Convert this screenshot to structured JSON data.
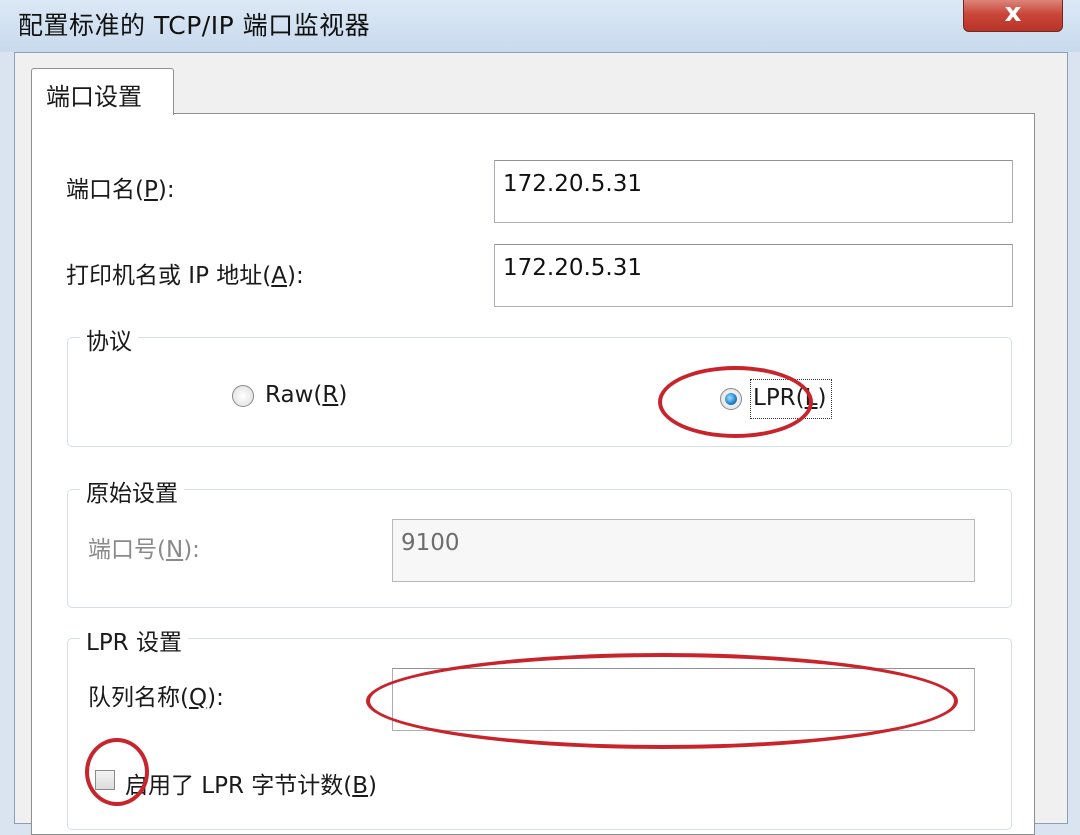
{
  "window": {
    "title": "配置标准的 TCP/IP 端口监视器",
    "close_glyph": "x"
  },
  "tab": {
    "label": "端口设置"
  },
  "port_name": {
    "label_pre": "端口名(",
    "mnemonic": "P",
    "label_post": "):",
    "value": "172.20.5.31"
  },
  "printer_name": {
    "label_pre": "打印机名或 IP 地址(",
    "mnemonic": "A",
    "label_post": "):",
    "value": "172.20.5.31"
  },
  "protocol": {
    "legend": "协议",
    "raw": {
      "label_pre": "Raw(",
      "mnemonic": "R",
      "label_post": ")",
      "checked": false
    },
    "lpr": {
      "label_pre": "LPR(",
      "mnemonic": "L",
      "label_post": ")",
      "checked": true
    }
  },
  "raw_settings": {
    "legend": "原始设置",
    "port_number": {
      "label_pre": "端口号(",
      "mnemonic": "N",
      "label_post": "):",
      "value": "9100"
    }
  },
  "lpr_settings": {
    "legend": "LPR 设置",
    "queue_name": {
      "label_pre": "队列名称(",
      "mnemonic": "Q",
      "label_post": "):",
      "value": ""
    },
    "byte_count": {
      "label_pre": "启用了 LPR 字节计数(",
      "mnemonic": "B",
      "label_post": ")",
      "checked": false
    }
  },
  "colors": {
    "annotation": "#c8242c",
    "accent": "#1f7fc9"
  }
}
